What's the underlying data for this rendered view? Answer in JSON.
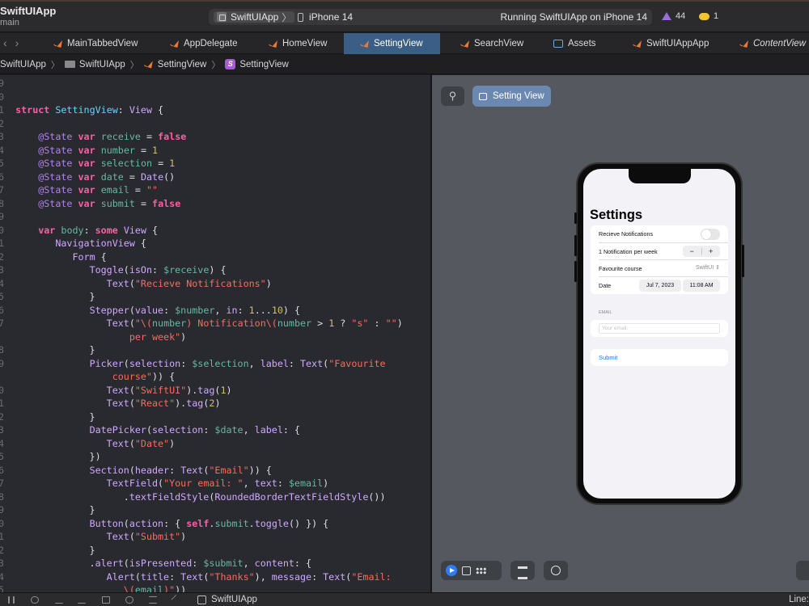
{
  "toolbar": {
    "project_title": "SwiftUIApp",
    "branch": "main",
    "scheme_app": "SwiftUIApp",
    "scheme_device": "iPhone 14",
    "run_status": "Running SwiftUIApp on iPhone 14",
    "warnings_count": "44",
    "issues_count": "1"
  },
  "tabs": [
    {
      "label": "MainTabbedView",
      "icon": "swift-file-icon"
    },
    {
      "label": "AppDelegate",
      "icon": "swift-file-icon"
    },
    {
      "label": "HomeView",
      "icon": "swift-file-icon"
    },
    {
      "label": "SettingView",
      "icon": "swift-file-icon",
      "active": true
    },
    {
      "label": "SearchView",
      "icon": "swift-file-icon"
    },
    {
      "label": "Assets",
      "icon": "asset-catalog-icon"
    },
    {
      "label": "SwiftUIAppApp",
      "icon": "swift-file-icon"
    },
    {
      "label": "ContentView",
      "icon": "swift-file-icon"
    }
  ],
  "breadcrumb": {
    "project": "SwiftUIApp",
    "folder": "SwiftUIApp",
    "file": "SettingView",
    "symbol": "SettingView"
  },
  "line_numbers": [
    "9",
    "0",
    "1",
    "2",
    "3",
    "4",
    "5",
    "6",
    "7",
    "8",
    "9",
    "0",
    "1",
    "2",
    "3",
    "4",
    "5",
    "6",
    "7",
    "",
    "8",
    "9",
    "",
    "0",
    "1",
    "2",
    "3",
    "4",
    "5",
    "6",
    "7",
    "8",
    "9",
    "0",
    "1",
    "2",
    "3",
    "4",
    "5",
    ""
  ],
  "preview": {
    "pin_label": "",
    "title": "Setting View"
  },
  "device_ui": {
    "nav_title": "Settings",
    "toggle_label": "Recieve Notifications",
    "stepper_label": "1 Notification per week",
    "stepper_minus": "−",
    "stepper_plus": "+",
    "picker_label": "Favourite course",
    "picker_value": "SwiftUI",
    "date_label": "Date",
    "date_value": "Jul 7, 2023",
    "time_value": "11:08 AM",
    "email_header": "EMAIL",
    "email_placeholder": "Your email:",
    "submit_label": "Submit"
  },
  "statusbar": {
    "app": "SwiftUIApp",
    "position": "Line:"
  }
}
